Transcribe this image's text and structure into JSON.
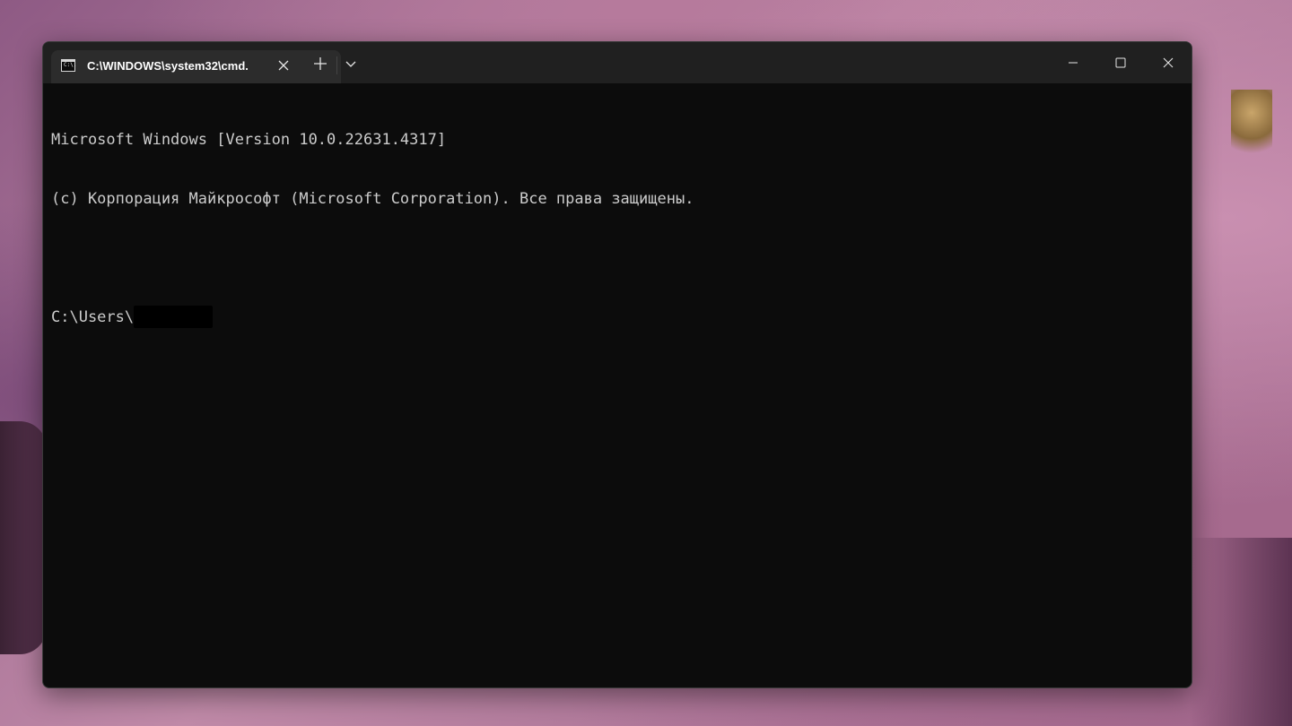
{
  "window": {
    "tab_title": "C:\\WINDOWS\\system32\\cmd.",
    "tab_icon_text": "C:\\."
  },
  "console": {
    "lines": [
      "Microsoft Windows [Version 10.0.22631.4317]",
      "(c) Корпорация Майкрософт (Microsoft Corporation). Все права защищены.",
      ""
    ],
    "prompt": "C:\\Users\\"
  },
  "icons": {
    "tab": "terminal-icon",
    "tab_close": "close-icon",
    "new_tab": "plus-icon",
    "dropdown": "chevron-down-icon",
    "minimize": "minimize-icon",
    "maximize": "maximize-icon",
    "close": "close-icon"
  },
  "colors": {
    "console_bg": "#0c0c0c",
    "console_text": "#cccccc",
    "titlebar_bg": "#202020",
    "tab_bg": "#2c2c2c"
  }
}
